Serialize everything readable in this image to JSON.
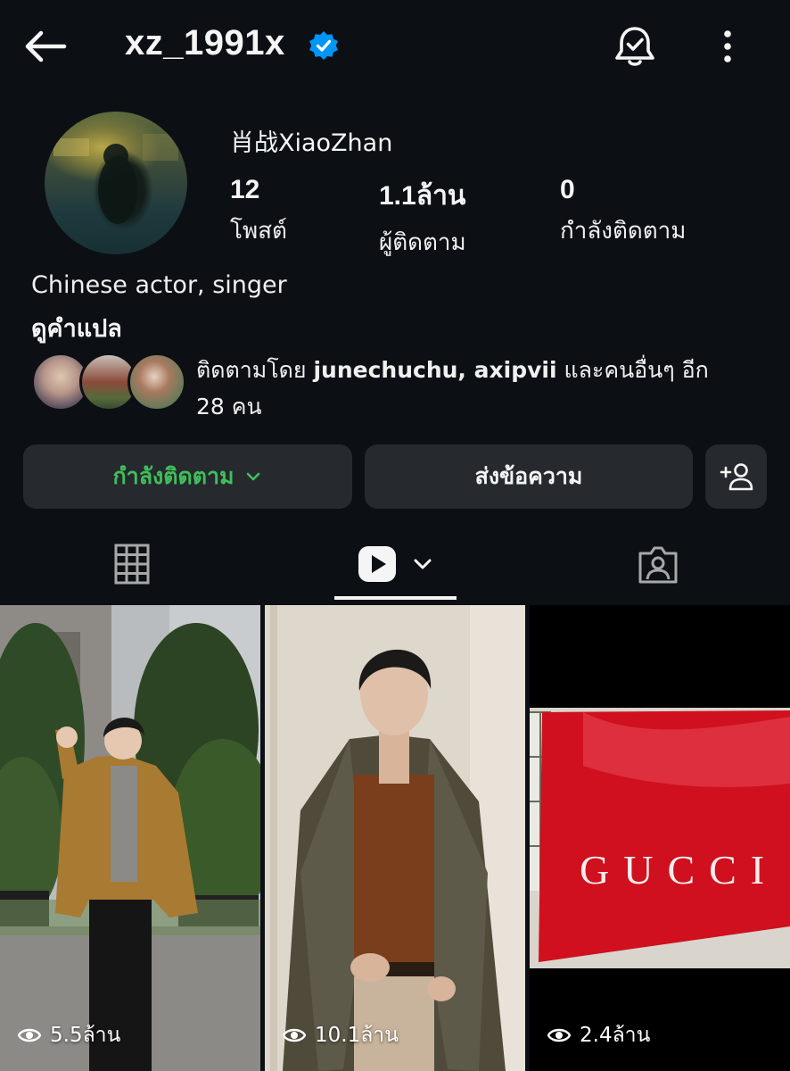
{
  "header": {
    "username": "xz_1991x",
    "verified": true,
    "icons": [
      "back-arrow-icon",
      "verified-badge-icon",
      "notification-bell-check-icon",
      "more-vertical-icon"
    ]
  },
  "profile": {
    "display_name": "肖战XiaoZhan",
    "stats": [
      {
        "value": "12",
        "label": "โพสต์"
      },
      {
        "value": "1.1ล้าน",
        "label": "ผู้ติดตาม"
      },
      {
        "value": "0",
        "label": "กำลังติดตาม"
      }
    ],
    "bio": "Chinese actor, singer",
    "translate_label": "ดูคำแปล"
  },
  "followed_by": {
    "prefix": "ติดตามโดย ",
    "names": "junechuchu, axipvii",
    "suffix": " และคนอื่นๆ อีก",
    "count_text": "28 คน"
  },
  "actions": {
    "following_label": "กำลังติดตาม",
    "message_label": "ส่งข้อความ"
  },
  "tabs": {
    "active": "reels",
    "items": [
      "grid-icon",
      "reels-icon",
      "tagged-icon"
    ]
  },
  "reels": [
    {
      "views": "5.5ล้าน"
    },
    {
      "views": "10.1ล้าน"
    },
    {
      "views": "2.4ล้าน",
      "sign_text": "GUCCI"
    }
  ],
  "colors": {
    "background": "#0c1014",
    "button_bg": "#262a2f",
    "following_green": "#3fbf5a",
    "verified_blue": "#0095f6",
    "gucci_red": "#d0101e"
  }
}
